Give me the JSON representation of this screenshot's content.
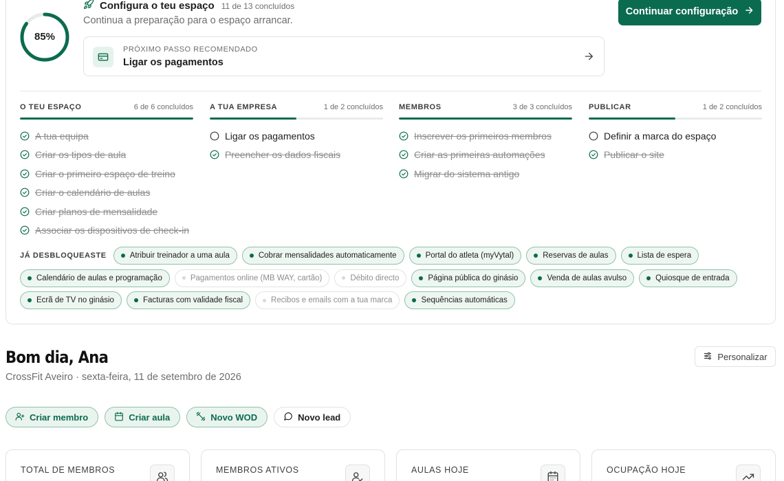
{
  "setup": {
    "progress_percent": 85,
    "progress_label": "85%",
    "title": "Configura o teu espaço",
    "count": "11 de 13 concluídos",
    "subtitle": "Continua a preparação para o espaço arrancar.",
    "continue_label": "Continuar configuração",
    "next_step": {
      "kicker": "PRÓXIMO PASSO RECOMENDADO",
      "title": "Ligar os pagamentos"
    },
    "columns": [
      {
        "title": "O TEU ESPAÇO",
        "count": "6 de 6 concluídos",
        "progress": 1.0,
        "items": [
          {
            "label": "A tua equipa",
            "done": true
          },
          {
            "label": "Criar os tipos de aula",
            "done": true
          },
          {
            "label": "Criar o primeiro espaço de treino",
            "done": true
          },
          {
            "label": "Criar o calendário de aulas",
            "done": true
          },
          {
            "label": "Criar planos de mensalidade",
            "done": true
          },
          {
            "label": "Associar os dispositivos de check-in",
            "done": true
          }
        ]
      },
      {
        "title": "A TUA EMPRESA",
        "count": "1 de 2 concluídos",
        "progress": 0.5,
        "items": [
          {
            "label": "Ligar os pagamentos",
            "done": false
          },
          {
            "label": "Preencher os dados fiscais",
            "done": true
          }
        ]
      },
      {
        "title": "MEMBROS",
        "count": "3 de 3 concluídos",
        "progress": 1.0,
        "items": [
          {
            "label": "Inscrever os primeiros membros",
            "done": true
          },
          {
            "label": "Criar as primeiras automações",
            "done": true
          },
          {
            "label": "Migrar do sistema antigo",
            "done": true
          }
        ]
      },
      {
        "title": "PUBLICAR",
        "count": "1 de 2 concluídos",
        "progress": 0.5,
        "items": [
          {
            "label": "Definir a marca do espaço",
            "done": false
          },
          {
            "label": "Publicar o site",
            "done": true
          }
        ]
      }
    ],
    "unlocked_label": "JÁ DESBLOQUEASTE",
    "unlocked_rows": [
      [
        {
          "label": "Atribuir treinador a uma aula",
          "active": true
        },
        {
          "label": "Cobrar mensalidades automaticamente",
          "active": true
        },
        {
          "label": "Portal do atleta (myVytal)",
          "active": true
        },
        {
          "label": "Reservas de aulas",
          "active": true
        },
        {
          "label": "Lista de espera",
          "active": true
        }
      ],
      [
        {
          "label": "Calendário de aulas e programação",
          "active": true
        },
        {
          "label": "Pagamentos online (MB WAY, cartão)",
          "active": false
        },
        {
          "label": "Débito directo",
          "active": false
        },
        {
          "label": "Página pública do ginásio",
          "active": true
        },
        {
          "label": "Venda de aulas avulso",
          "active": true
        },
        {
          "label": "Quiosque de entrada",
          "active": true
        }
      ],
      [
        {
          "label": "Ecrã de TV no ginásio",
          "active": true
        },
        {
          "label": "Facturas com validade fiscal",
          "active": true
        },
        {
          "label": "Recibos e emails com a tua marca",
          "active": false
        },
        {
          "label": "Sequências automáticas",
          "active": true
        }
      ]
    ]
  },
  "greeting": {
    "title": "Bom dia, Ana",
    "subtitle": "CrossFit Aveiro · sexta-feira, 11 de setembro de 2026",
    "personalize_label": "Personalizar"
  },
  "quick_actions": [
    {
      "label": "Criar membro",
      "icon": "user-plus-icon"
    },
    {
      "label": "Criar aula",
      "icon": "calendar-icon"
    },
    {
      "label": "Novo WOD",
      "icon": "dumbbell-icon"
    },
    {
      "label": "Novo lead",
      "icon": "message-circle-icon"
    }
  ],
  "stats": [
    {
      "label": "TOTAL DE MEMBROS",
      "icon": "users-icon"
    },
    {
      "label": "MEMBROS ATIVOS",
      "icon": "user-check-icon"
    },
    {
      "label": "AULAS HOJE",
      "icon": "calendar-icon"
    },
    {
      "label": "OCUPAÇÃO HOJE",
      "icon": "trending-up-icon"
    }
  ],
  "colors": {
    "accent": "#0b6b4f",
    "accent_soft": "#e6f2ec"
  }
}
